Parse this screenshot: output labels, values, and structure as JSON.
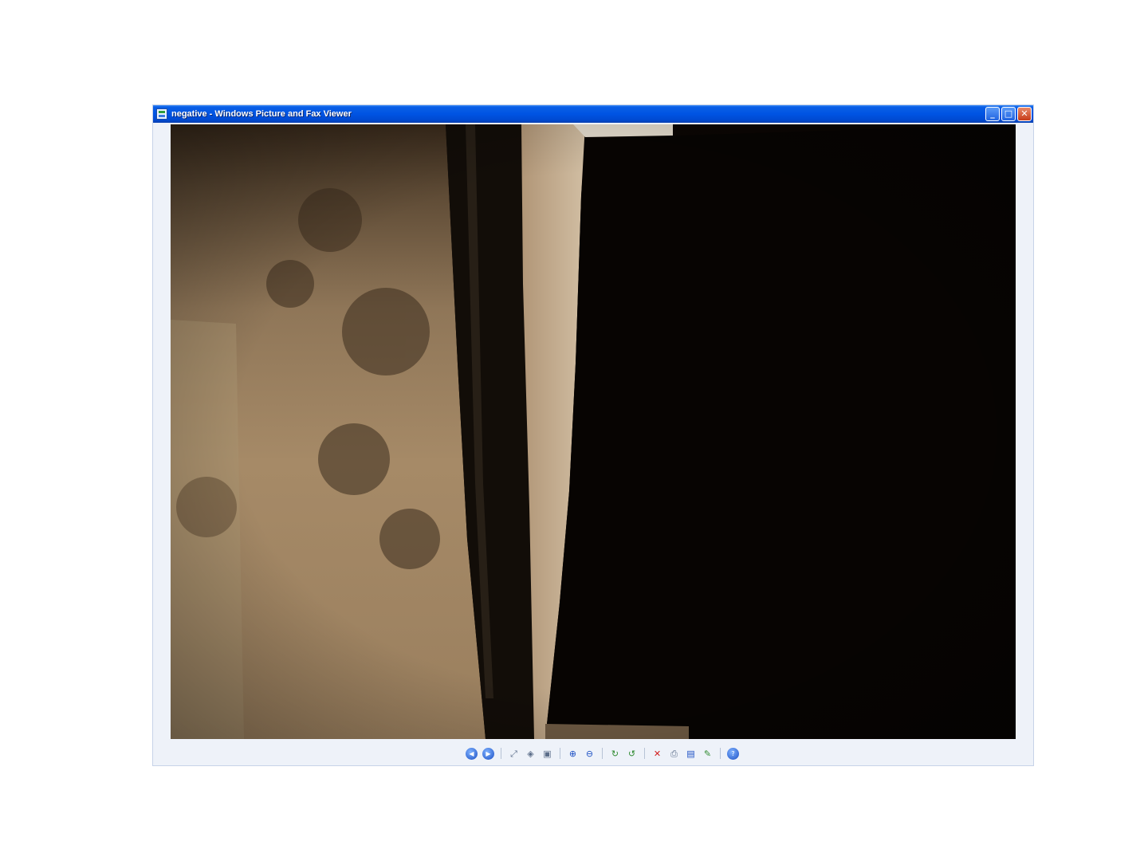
{
  "window": {
    "title": "negative - Windows Picture and Fax Viewer",
    "controls": {
      "minimize": "_",
      "maximize": "□",
      "close": "✕"
    }
  },
  "toolbar": {
    "tools": [
      {
        "name": "previous-image-icon",
        "glyph": "◀"
      },
      {
        "name": "next-image-icon",
        "glyph": "▶"
      },
      {
        "name": "best-fit-icon",
        "glyph": "⤢"
      },
      {
        "name": "actual-size-icon",
        "glyph": "◈"
      },
      {
        "name": "slideshow-icon",
        "glyph": "▣"
      },
      {
        "name": "zoom-in-icon",
        "glyph": "⊕"
      },
      {
        "name": "zoom-out-icon",
        "glyph": "⊖"
      },
      {
        "name": "rotate-clockwise-icon",
        "glyph": "↻"
      },
      {
        "name": "rotate-counterclockwise-icon",
        "glyph": "↺"
      },
      {
        "name": "delete-icon",
        "glyph": "✕"
      },
      {
        "name": "print-icon",
        "glyph": "⎙"
      },
      {
        "name": "save-icon",
        "glyph": "▤"
      },
      {
        "name": "edit-icon",
        "glyph": "✎"
      },
      {
        "name": "help-icon",
        "glyph": "?"
      }
    ]
  }
}
